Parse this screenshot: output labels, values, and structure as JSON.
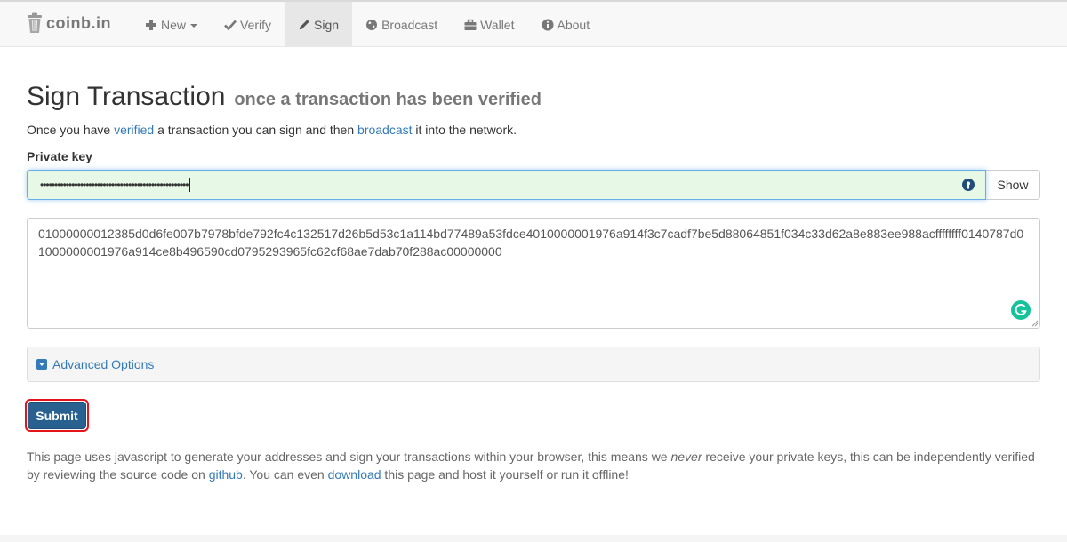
{
  "brand": {
    "name": "coinb.in"
  },
  "nav": {
    "new": "New",
    "verify": "Verify",
    "sign": "Sign",
    "broadcast": "Broadcast",
    "wallet": "Wallet",
    "about": "About",
    "active": "Sign"
  },
  "page": {
    "title": "Sign Transaction",
    "subtitle": "once a transaction has been verified",
    "intro": {
      "before": "Once you have ",
      "verified_link": "verified",
      "middle": " a transaction you can sign and then ",
      "broadcast_link": "broadcast",
      "after": " it into the network."
    }
  },
  "form": {
    "private_key_label": "Private key",
    "private_key_masked": "••••••••••••••••••••••••••••••••••••••••••••••••••••",
    "show_button": "Show",
    "transaction_hex": "01000000012385d0d6fe007b7978bfde792fc4c132517d26b5d53c1a114bd77489a53fdce4010000001976a914f3c7cadf7be5d88064851f034c33d62a8e883ee988acffffffff0140787d01000000001976a914ce8b496590cd0795293965fc62cf68ae7dab70f288ac00000000",
    "advanced_options": "Advanced Options",
    "submit_button": "Submit"
  },
  "footer": {
    "p1": "This page uses javascript to generate your addresses and sign your transactions within your browser, this means we ",
    "never": "never",
    "p2": " receive your private keys, this can be independently verified by reviewing the source code on ",
    "github_link": "github",
    "p3": ". You can even ",
    "download_link": "download",
    "p4": " this page and host it yourself or run it offline!"
  },
  "colors": {
    "link": "#337ab7",
    "submit_bg": "#286090",
    "highlight_border": "#e3141a",
    "key_input_bg": "#e8f8e6"
  },
  "icons": {
    "brand": "trash-bin-logo-icon",
    "new": "plus-icon",
    "verify": "checkmark-icon",
    "sign": "pencil-icon",
    "broadcast": "globe-icon",
    "wallet": "briefcase-icon",
    "about": "info-circle-icon",
    "key_badge": "password-manager-icon",
    "grammarly": "grammarly-icon",
    "advanced": "chevron-down-square-icon"
  }
}
